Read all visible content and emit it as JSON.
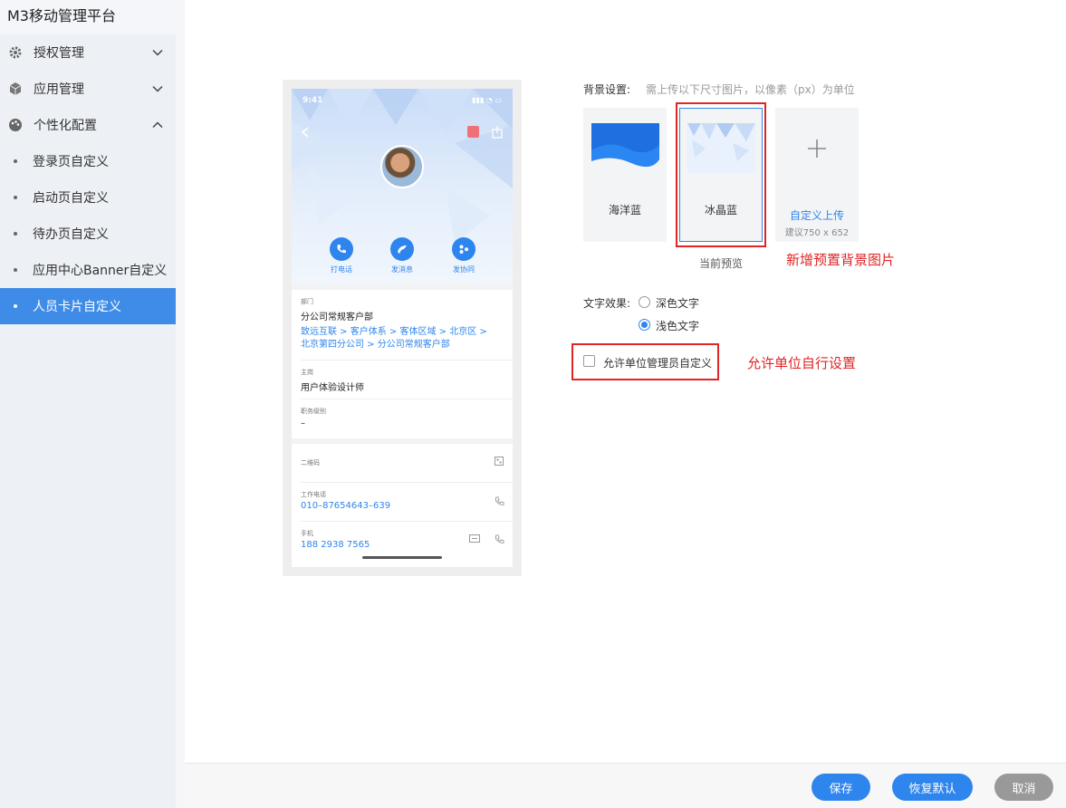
{
  "app": {
    "title": "M3移动管理平台"
  },
  "sidebar": {
    "menus": [
      {
        "label": "授权管理",
        "icon": "gear-icon"
      },
      {
        "label": "应用管理",
        "icon": "cube-icon"
      },
      {
        "label": "个性化配置",
        "icon": "palette-icon"
      }
    ],
    "submenus": [
      {
        "label": "登录页自定义"
      },
      {
        "label": "启动页自定义"
      },
      {
        "label": "待办页自定义"
      },
      {
        "label": "应用中心Banner自定义"
      },
      {
        "label": "人员卡片自定义"
      }
    ],
    "active": "人员卡片自定义"
  },
  "phone": {
    "status_time": "9:41",
    "actions": [
      {
        "label": "打电话",
        "icon": "phone-icon"
      },
      {
        "label": "发消息",
        "icon": "message-icon"
      },
      {
        "label": "发协同",
        "icon": "share-icon"
      }
    ],
    "fields": {
      "dept_label": "部门",
      "dept_value": "分公司常规客户部",
      "dept_path": "致远互联 > 客户体系 > 客体区域 > 北京区 > 北京第四分公司 > 分公司常规客户部",
      "post_label": "主岗",
      "post_value": "用户体验设计师",
      "level_label": "职务级别",
      "level_value": "–",
      "qr_label": "二维码",
      "work_phone_label": "工作电话",
      "work_phone_value": "010–87654643–639",
      "mobile_label": "手机",
      "mobile_value": "188 2938 7565"
    }
  },
  "settings": {
    "bg_label": "背景设置:",
    "bg_hint": "需上传以下尺寸图片，以像素（px）为单位",
    "backgrounds": [
      {
        "name": "海洋蓝"
      },
      {
        "name": "冰晶蓝"
      }
    ],
    "upload_label": "自定义上传",
    "upload_hint": "建议750 x 652",
    "preview_caption": "当前预览",
    "note_bg": "新增预置背景图片",
    "text_effect_label": "文字效果:",
    "text_options": [
      {
        "label": "深色文字",
        "checked": false
      },
      {
        "label": "浅色文字",
        "checked": true
      }
    ],
    "allow_label": "允许单位管理员自定义",
    "note_allow": "允许单位自行设置"
  },
  "footer": {
    "save": "保存",
    "reset": "恢复默认",
    "cancel": "取消"
  },
  "colors": {
    "accent": "#2e85ee",
    "active_menu": "#3f8ce8",
    "annotation": "#e02525"
  }
}
